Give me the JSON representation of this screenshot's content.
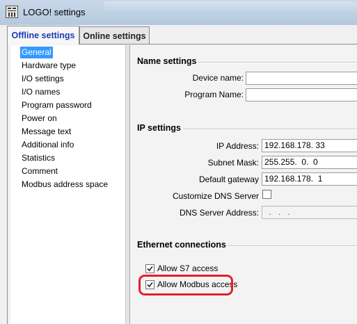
{
  "window": {
    "title": "LOGO! settings",
    "icon": "logo-app-icon"
  },
  "tabs": [
    {
      "label": "Offline settings",
      "active": true
    },
    {
      "label": "Online settings",
      "active": false
    }
  ],
  "nav": {
    "items": [
      {
        "label": "General",
        "selected": true
      },
      {
        "label": "Hardware type"
      },
      {
        "label": "I/O settings"
      },
      {
        "label": "I/O names"
      },
      {
        "label": "Program password"
      },
      {
        "label": "Power on"
      },
      {
        "label": "Message text"
      },
      {
        "label": "Additional info"
      },
      {
        "label": "Statistics"
      },
      {
        "label": "Comment"
      },
      {
        "label": "Modbus address space"
      }
    ]
  },
  "name_settings": {
    "heading": "Name settings",
    "device_name": {
      "label": "Device name:",
      "value": ""
    },
    "program_name": {
      "label": "Program Name:",
      "value": ""
    }
  },
  "ip_settings": {
    "heading": "IP settings",
    "ip_address": {
      "label": "IP Address:",
      "value": "192.168.178. 33"
    },
    "subnet_mask": {
      "label": "Subnet Mask:",
      "value": "255.255.  0.  0"
    },
    "default_gateway": {
      "label": "Default gateway",
      "value": "192.168.178.  1"
    },
    "customize_dns": {
      "label": "Customize DNS Server",
      "checked": false
    },
    "dns_server": {
      "label": "DNS Server Address:",
      "value": "  .   .   ."
    }
  },
  "ethernet": {
    "heading": "Ethernet connections",
    "allow_s7": {
      "label": "Allow S7 access",
      "checked": true
    },
    "allow_modbus": {
      "label": "Allow Modbus access",
      "checked": true,
      "highlight_color": "#e2202a"
    }
  },
  "colors": {
    "accent": "#1b3cb7",
    "selection": "#3399ff",
    "highlight": "#e2202a"
  }
}
